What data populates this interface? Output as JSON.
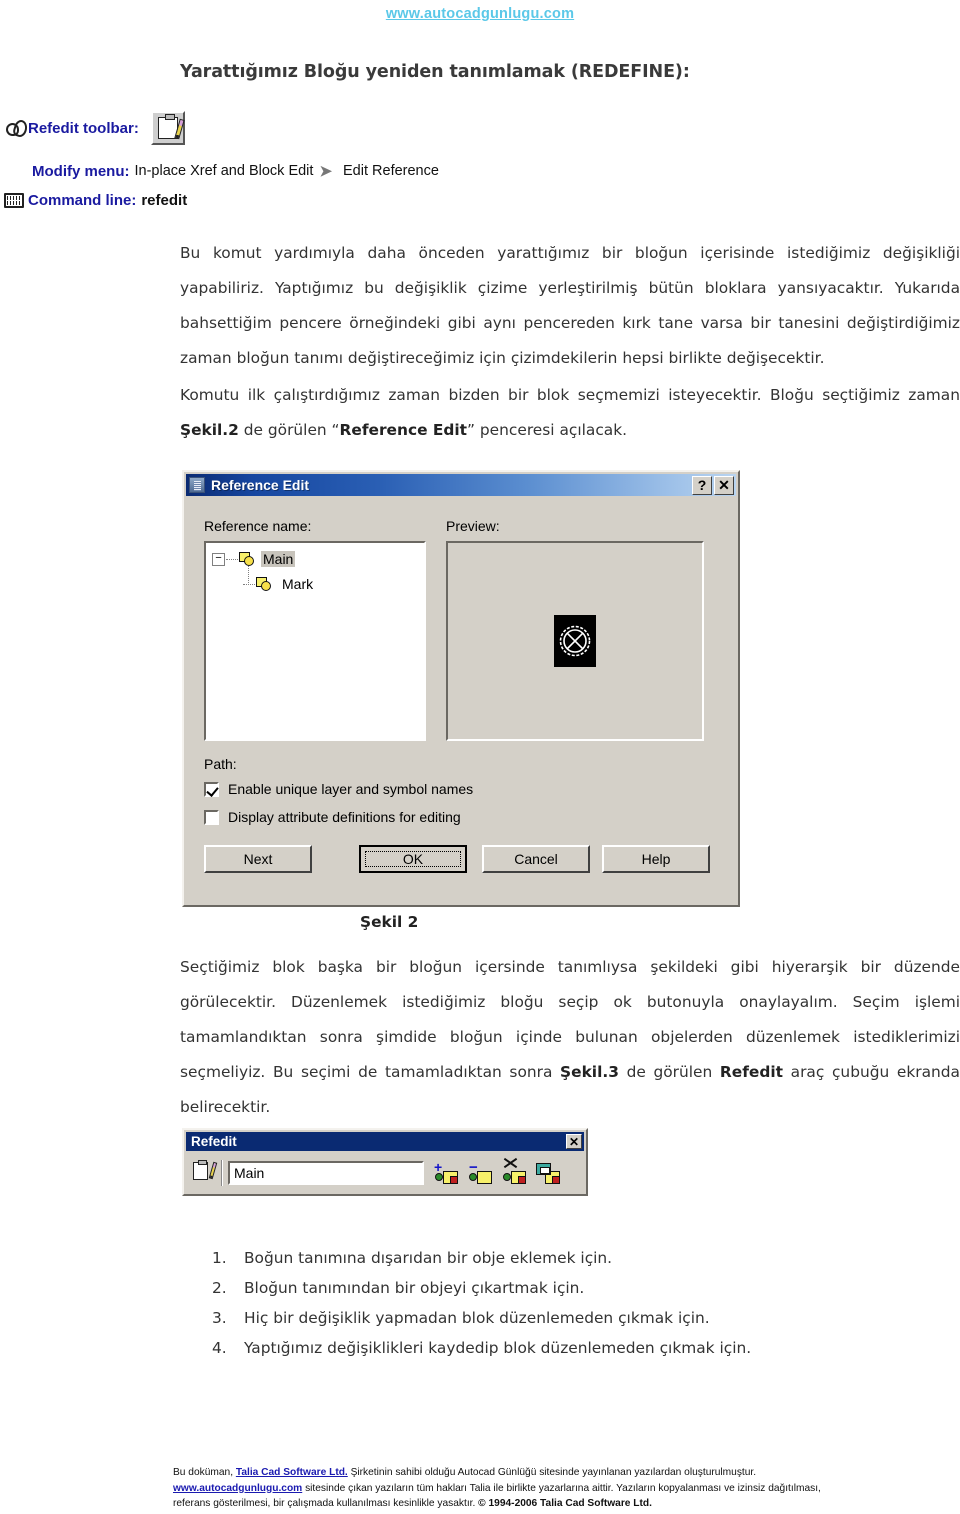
{
  "header": {
    "site_url": "www.autocadgunlugu.com"
  },
  "title": "Yarattığımız Bloğu yeniden tanımlamak (REDEFINE):",
  "command_ref": {
    "toolbar_label": "Refedit toolbar:",
    "menu_label": "Modify menu:",
    "menu_value_1": "In-place Xref and Block Edit",
    "menu_arrow": "➤",
    "menu_value_2": "Edit Reference",
    "cmdline_label": "Command line:",
    "cmdline_value": "refedit"
  },
  "paragraphs": {
    "p1_a": "Bu komut yardımıyla daha önceden yarattığımız bir bloğun içerisinde istediğimiz değişikliği yapabiliriz. Yaptığımız bu değişiklik çizime yerleştirilmiş bütün bloklara yansıyacaktır. Yukarıda bahsettiğim pencere örneğindeki gibi aynı pencereden kırk tane varsa bir tanesini değiştirdiğimiz zaman bloğun tanımı değiştireceğimiz için çizimdekilerin hepsi birlikte değişecektir.",
    "p2_a": "Komutu ilk çalıştırdığımız zaman bizden bir blok seçmemizi isteyecektir. Bloğu seçtiğimiz zaman ",
    "p2_b": "Şekil.2",
    "p2_c": " de görülen “",
    "p2_d": "Reference Edit",
    "p2_e": "” penceresi açılacak.",
    "p3_a": "Seçtiğimiz blok başka bir bloğun içersinde tanımlıysa şekildeki gibi hiyerarşik bir düzende görülecektir. Düzenlemek istediğimiz bloğu seçip ok butonuyla onaylayalım. Seçim işlemi tamamlandıktan sonra şimdide bloğun içinde bulunan objelerden düzenlemek istediklerimizi seçmeliyiz. Bu seçimi de tamamladıktan sonra ",
    "p3_b": "Şekil.3",
    "p3_c": " de görülen ",
    "p3_d": "Refedit",
    "p3_e": " araç çubuğu ekranda belirecektir."
  },
  "figure_captions": {
    "fig2": "Şekil 2"
  },
  "reference_edit_dialog": {
    "window_title": "Reference Edit",
    "help_button": "?",
    "close_button": "✕",
    "reference_name_label": "Reference name:",
    "preview_label": "Preview:",
    "path_label": "Path:",
    "tree": [
      {
        "label": "Main",
        "selected": true,
        "expander": "−"
      },
      {
        "label": "Mark",
        "selected": false,
        "expander": ""
      }
    ],
    "checkboxes": [
      {
        "label": "Enable unique layer and symbol names",
        "checked": true
      },
      {
        "label": "Display attribute definitions for editing",
        "checked": false
      }
    ],
    "buttons": [
      {
        "label": "Next",
        "default": false
      },
      {
        "label": "OK",
        "default": true
      },
      {
        "label": "Cancel",
        "default": false
      },
      {
        "label": "Help",
        "default": false
      }
    ]
  },
  "refedit_toolbar_window": {
    "window_title": "Refedit",
    "close_button": "✕",
    "block_name_value": "Main",
    "tool_icons": [
      "add-objects-to-working-set-icon",
      "remove-objects-from-working-set-icon",
      "discard-changes-to-reference-icon",
      "save-back-changes-to-reference-icon"
    ]
  },
  "numbered_list": [
    {
      "num": "1.",
      "text": "Boğun tanımına dışarıdan bir obje eklemek için."
    },
    {
      "num": "2.",
      "text": "Bloğun tanımından bir objeyi çıkartmak için."
    },
    {
      "num": "3.",
      "text": "Hiç bir değişiklik yapmadan blok düzenlemeden çıkmak için."
    },
    {
      "num": "4.",
      "text": "Yaptığımız değişiklikleri kaydedip blok düzenlemeden çıkmak için."
    }
  ],
  "footer": {
    "l1_a": "Bu doküman, ",
    "l1_link": "Talia Cad Software Ltd.",
    "l1_b": " Şirketinin sahibi olduğu  Autocad Günlüğü sitesinde yayınlanan yazılardan oluşturulmuştur.",
    "l2_link": "www.autocadgunlugu.com",
    "l2_a": " sitesinde çıkan yazıların tüm hakları Talia ile birlikte yazarlarına aittir. Yazıların kopyalanması ve izinsiz dağıtılması,",
    "l3_a": "referans gösterilmesi, bir çalışmada kullanılması kesinlikle yasaktır. ",
    "l3_b": "© 1994-2006 Talia Cad Software Ltd."
  },
  "colors": {
    "link_cyan": "#5bc8e8",
    "cmd_blue": "#1a1aa0",
    "dialog_face": "#d4d0c8",
    "title_blue": "#0a2a72",
    "block_yellow": "#f7f06a"
  }
}
